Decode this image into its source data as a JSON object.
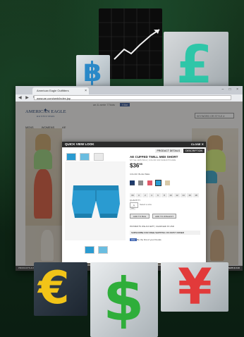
{
  "browser": {
    "tab_title": "American Eagle Outfitters",
    "url": "www.ae.com/web/index.jsp",
    "window_controls": "– □ ×"
  },
  "site": {
    "top_strip": "ae & aerie   77kids",
    "brand": "77kids",
    "facebook": "f like",
    "logo_line1": "AMERICAN EAGLE",
    "logo_line2": "OUTFITTERS",
    "search_placeholder": "KEYWORD OR STYLE #",
    "nav": [
      "MENS",
      "WOMENS",
      "AE"
    ]
  },
  "modal": {
    "title": "QUICK VIEW LOOK",
    "close_label": "CLOSE ✕",
    "tabs": [
      "PRODUCT DETAILS",
      "DESCRIPTION"
    ],
    "product_name": "AE CUFFED TWILL MIDI SHORT",
    "style_line": "STYLE 1165-5012 | COLOR 400   SIZE/FIT/CARE",
    "price_dollars": "$36",
    "price_cents": "95",
    "color_label": "COLOR: BLUE PEEL",
    "size_label": "SIZE",
    "sizes": [
      "00",
      "0",
      "2",
      "4",
      "6",
      "8",
      "10",
      "12",
      "14",
      "16",
      "18",
      "20"
    ],
    "quantity_label": "QUANTITY",
    "quantity_value": "1",
    "quantity_note": "Select a size",
    "add_to_bag": "ADD TO BAG",
    "add_to_wishlist": "ADD TO WISHLIST",
    "payment_line": "PAYMENTS WE ACCEPT   |   CHARGED IN USD",
    "subscribe_line": "SUBSCRIBE FOR FREE SHIPPING ON FIRST ORDER",
    "social_like": "Like",
    "social_text": "Be the first of your friends."
  },
  "statusbar": {
    "left": "PRODUCTS & PRICES SUBJECT TO CHANGE",
    "bag": "MY BAG   0 ITEMS   $ 0.00"
  },
  "colors": {
    "accent_blue": "#2a9bd1",
    "navy": "#1d3a6c",
    "pound_teal": "#2fc6a8",
    "baht_blue": "#2a89c8",
    "euro_yellow": "#f2c418",
    "dollar_green": "#2fae3a",
    "yen_red": "#e23a3a"
  },
  "icons": [
    "baht-icon",
    "pound-icon",
    "euro-icon",
    "dollar-icon",
    "yen-icon",
    "trend-graph-icon"
  ]
}
